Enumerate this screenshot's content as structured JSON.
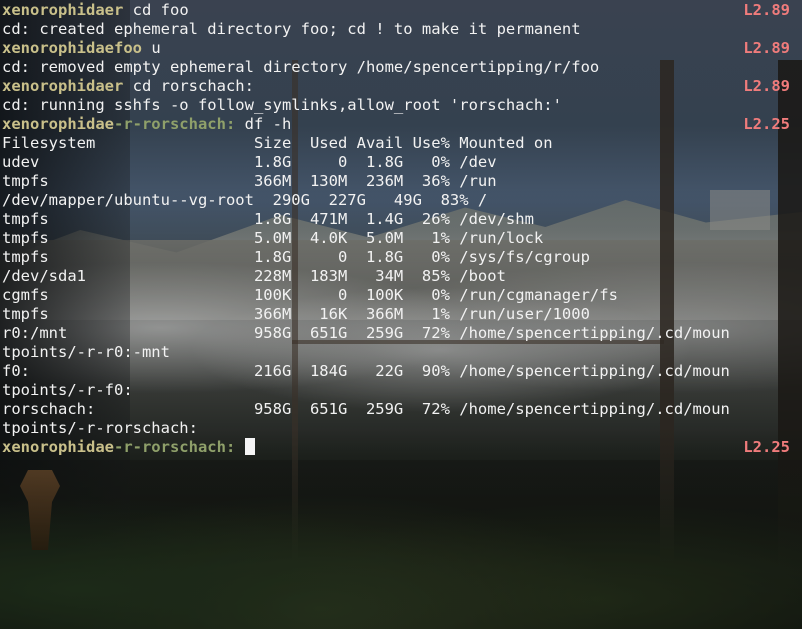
{
  "terminal": {
    "lines": [
      {
        "host": "xenorophidae",
        "cwd": "r",
        "cmd": " cd foo",
        "load": "L2.89"
      },
      {
        "out": "cd: created ephemeral directory foo; cd ! to make it permanent"
      },
      {
        "host": "xenorophidae",
        "cwd": "foo",
        "cmd": " u",
        "load": "L2.89"
      },
      {
        "out": "cd: removed empty ephemeral directory /home/spencertipping/r/foo"
      },
      {
        "host": "xenorophidae",
        "cwd": "r",
        "cmd": " cd rorschach:",
        "load": "L2.89"
      },
      {
        "out": "cd: running sshfs -o follow_symlinks,allow_root 'rorschach:'"
      },
      {
        "host": "xenorophidae",
        "cwd": "-r-rorschach:",
        "cmd": " df -h",
        "load": "L2.25"
      },
      {
        "out": "Filesystem                 Size  Used Avail Use% Mounted on"
      },
      {
        "out": "udev                       1.8G     0  1.8G   0% /dev"
      },
      {
        "out": "tmpfs                      366M  130M  236M  36% /run"
      },
      {
        "out": "/dev/mapper/ubuntu--vg-root  290G  227G   49G  83% /"
      },
      {
        "out": "tmpfs                      1.8G  471M  1.4G  26% /dev/shm"
      },
      {
        "out": "tmpfs                      5.0M  4.0K  5.0M   1% /run/lock"
      },
      {
        "out": "tmpfs                      1.8G     0  1.8G   0% /sys/fs/cgroup"
      },
      {
        "out": "/dev/sda1                  228M  183M   34M  85% /boot"
      },
      {
        "out": "cgmfs                      100K     0  100K   0% /run/cgmanager/fs"
      },
      {
        "out": "tmpfs                      366M   16K  366M   1% /run/user/1000"
      },
      {
        "out": "r0:/mnt                    958G  651G  259G  72% /home/spencertipping/.cd/moun"
      },
      {
        "out": "tpoints/-r-r0:-mnt"
      },
      {
        "out": "f0:                        216G  184G   22G  90% /home/spencertipping/.cd/moun"
      },
      {
        "out": "tpoints/-r-f0:"
      },
      {
        "out": "rorschach:                 958G  651G  259G  72% /home/spencertipping/.cd/moun"
      },
      {
        "out": "tpoints/-r-rorschach:"
      },
      {
        "host": "xenorophidae",
        "cwd": "-r-rorschach:",
        "cmd": " ",
        "load": "L2.25",
        "cursor": true
      }
    ]
  },
  "colors": {
    "hostname": "#c9c08a",
    "load": "#f07c7c",
    "text": "#f2f2f2"
  }
}
